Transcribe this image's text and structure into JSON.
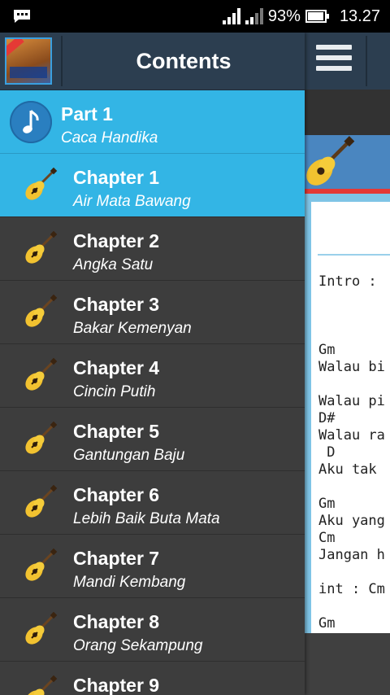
{
  "status_bar": {
    "battery": "93%",
    "time": "13.27",
    "battery_level": 0.93
  },
  "drawer": {
    "title": "Contents",
    "part": {
      "title": "Part 1",
      "subtitle": "Caca Handika"
    },
    "chapters": [
      {
        "title": "Chapter 1",
        "subtitle": "Air Mata Bawang",
        "active": true
      },
      {
        "title": "Chapter 2",
        "subtitle": "Angka Satu"
      },
      {
        "title": "Chapter 3",
        "subtitle": "Bakar Kemenyan"
      },
      {
        "title": "Chapter 4",
        "subtitle": "Cincin Putih"
      },
      {
        "title": "Chapter 5",
        "subtitle": "Gantungan Baju"
      },
      {
        "title": "Chapter 6",
        "subtitle": "Lebih Baik Buta Mata"
      },
      {
        "title": "Chapter 7",
        "subtitle": "Mandi Kembang"
      },
      {
        "title": "Chapter 8",
        "subtitle": "Orang Sekampung"
      },
      {
        "title": "Chapter 9",
        "subtitle": ""
      }
    ]
  },
  "content": {
    "lyrics_visible": "Intro :\n\n\n\nGm\nWalau bi\n\nWalau pi\nD#\nWalau ra\n D\nAku tak \n\nGm\nAku yang\nCm\nJangan h\n\nint : Cm\n\nGm"
  },
  "colors": {
    "accent": "#33b5e5",
    "appbar": "#2c3e50",
    "drawer_bg": "#3d3d3d",
    "banner": "#4a86c0",
    "red_line": "#e53935"
  }
}
